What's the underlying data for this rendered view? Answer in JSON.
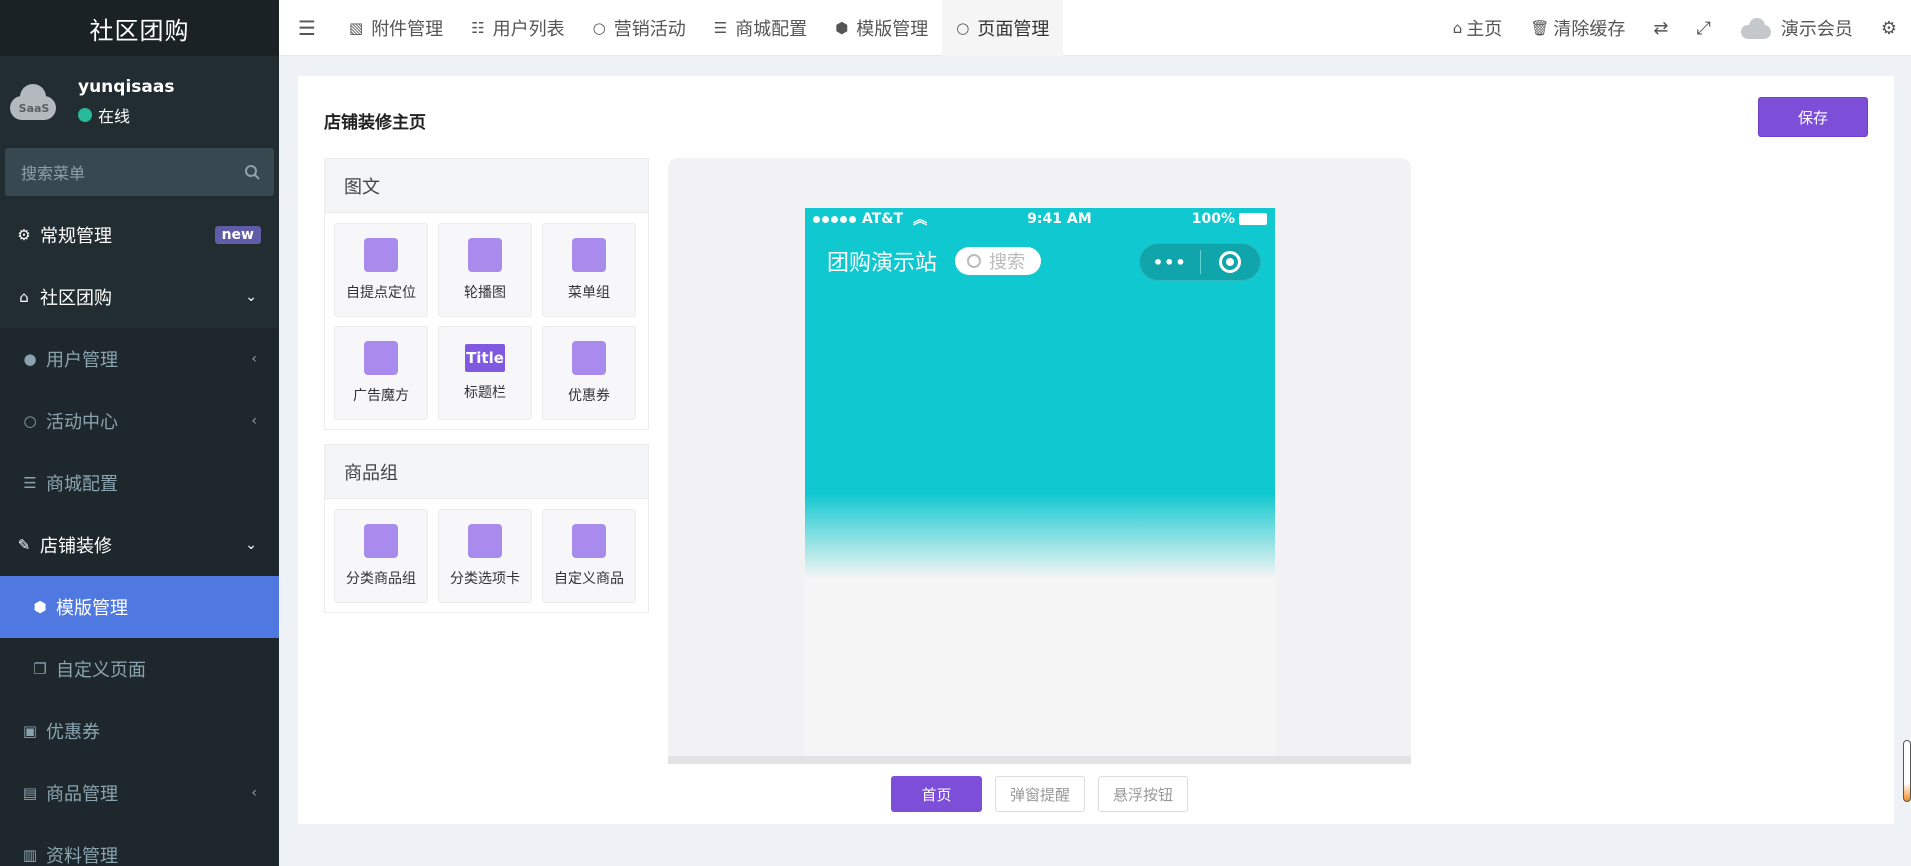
{
  "sidebar": {
    "brand": "社区团购",
    "user": {
      "avatar_text": "SaaS",
      "name": "yunqisaas",
      "status": "在线"
    },
    "search_placeholder": "搜索菜单",
    "items": [
      {
        "label": "常规管理",
        "icon": "cogs-icon",
        "badge": "new"
      },
      {
        "label": "社区团购",
        "icon": "home-icon",
        "arrow": "⌄"
      },
      {
        "label": "用户管理",
        "icon": "user-icon",
        "arrow": "‹"
      },
      {
        "label": "活动中心",
        "icon": "circle-icon",
        "arrow": "‹"
      },
      {
        "label": "商城配置",
        "icon": "sliders-icon"
      },
      {
        "label": "店铺装修",
        "icon": "brush-icon",
        "arrow": "⌄"
      },
      {
        "label": "模版管理",
        "icon": "cubes-icon"
      },
      {
        "label": "自定义页面",
        "icon": "copy-icon"
      },
      {
        "label": "优惠券",
        "icon": "money-icon"
      },
      {
        "label": "商品管理",
        "icon": "archive-icon",
        "arrow": "‹"
      },
      {
        "label": "资料管理",
        "icon": "file-icon"
      }
    ]
  },
  "topbar": {
    "tabs": [
      {
        "label": "附件管理",
        "icon": "image-icon"
      },
      {
        "label": "用户列表",
        "icon": "list-icon"
      },
      {
        "label": "营销活动",
        "icon": "circle-icon"
      },
      {
        "label": "商城配置",
        "icon": "sliders-icon"
      },
      {
        "label": "模版管理",
        "icon": "cubes-icon"
      },
      {
        "label": "页面管理",
        "icon": "circle-icon"
      }
    ],
    "right": {
      "home": "主页",
      "clear_cache": "清除缓存",
      "member": "演示会员"
    }
  },
  "page": {
    "title": "店铺装修主页",
    "save": "保存",
    "groups": [
      {
        "title": "图文",
        "items": [
          "自提点定位",
          "轮播图",
          "菜单组",
          "广告魔方",
          "标题栏",
          "优惠券"
        ]
      },
      {
        "title": "商品组",
        "items": [
          "分类商品组",
          "分类选项卡",
          "自定义商品"
        ]
      }
    ],
    "title_icon_text": "Title"
  },
  "phone": {
    "carrier": "AT&T",
    "time": "9:41 AM",
    "battery": "100%",
    "store_name": "团购演示站",
    "search_placeholder": "搜索",
    "capsule_more": "•••"
  },
  "preview_buttons": [
    "首页",
    "弹窗提醒",
    "悬浮按钮"
  ],
  "colors": {
    "accent": "#7d4ed8",
    "sidebar": "#222d32",
    "active": "#4f79e0",
    "phone_header": "#10c8cf"
  }
}
